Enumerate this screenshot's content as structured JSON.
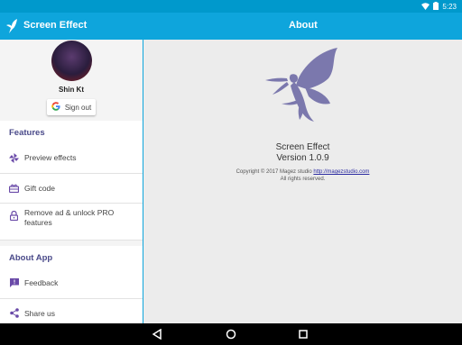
{
  "status": {
    "time": "5:23"
  },
  "appbar": {
    "app_title": "Screen Effect",
    "page_title": "About"
  },
  "drawer": {
    "user_name": "Shin Kt",
    "signout_label": "Sign out",
    "sections": [
      {
        "title": "Features",
        "items": [
          {
            "label": "Preview effects",
            "icon": "pinwheel-icon"
          },
          {
            "label": "Gift code",
            "icon": "gift-icon"
          },
          {
            "label": "Remove ad & unlock PRO features",
            "line1": "Remove ad & unlock PRO",
            "line2": "features",
            "icon": "lock-icon"
          }
        ]
      },
      {
        "title": "About App",
        "items": [
          {
            "label": "Feedback",
            "icon": "feedback-icon"
          },
          {
            "label": "Share us",
            "icon": "share-icon"
          }
        ]
      }
    ]
  },
  "about": {
    "title": "Screen Effect",
    "version": "Version 1.0.9",
    "copyright_prefix": "Copyright © 2017 Magez studio ",
    "link": "http://magezstudio.com",
    "rights": "All rights reserved."
  },
  "colors": {
    "accent": "#0ea5dc",
    "status": "#0099cc",
    "section": "#4a4a8a",
    "fairy": "#7b78ad"
  }
}
